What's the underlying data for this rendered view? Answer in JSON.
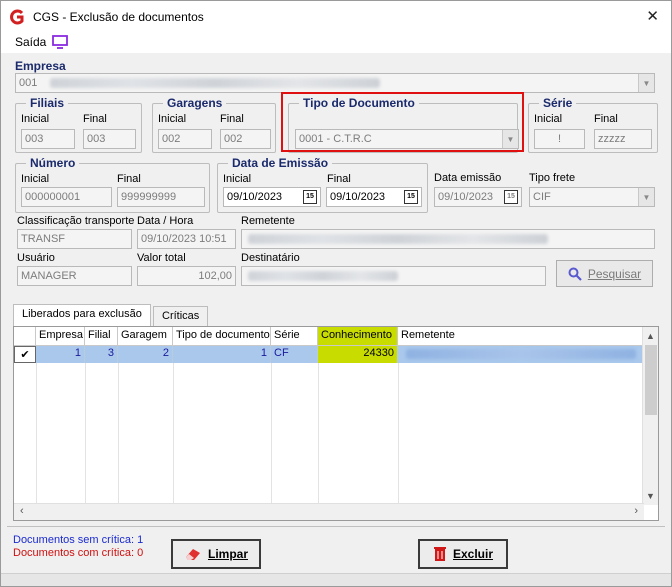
{
  "window": {
    "title": "CGS - Exclusão de documentos",
    "close_glyph": "✕"
  },
  "menu": {
    "saida": "Saída"
  },
  "empresa": {
    "label": "Empresa",
    "value": "001"
  },
  "filiais": {
    "label": "Filiais",
    "inicial_label": "Inicial",
    "final_label": "Final",
    "inicial": "003",
    "final": "003"
  },
  "garagens": {
    "label": "Garagens",
    "inicial_label": "Inicial",
    "final_label": "Final",
    "inicial": "002",
    "final": "002"
  },
  "tipo_documento": {
    "label": "Tipo de Documento",
    "value": "0001 - C.T.R.C"
  },
  "serie": {
    "label": "Série",
    "inicial_label": "Inicial",
    "final_label": "Final",
    "inicial": "!",
    "final": "zzzzz"
  },
  "numero": {
    "label": "Número",
    "inicial_label": "Inicial",
    "final_label": "Final",
    "inicial": "000000001",
    "final": "999999999"
  },
  "data_emissao": {
    "label": "Data de Emissão",
    "inicial_label": "Inicial",
    "final_label": "Final",
    "inicial": "09/10/2023",
    "final": "09/10/2023",
    "cal_glyph": "15"
  },
  "data_emissao_single": {
    "label": "Data emissão",
    "value": "09/10/2023"
  },
  "tipo_frete": {
    "label": "Tipo frete",
    "value": "CIF"
  },
  "classificacao": {
    "label": "Classificação transporte",
    "value": "TRANSF"
  },
  "data_hora": {
    "label": "Data / Hora",
    "value": "09/10/2023 10:51"
  },
  "remetente": {
    "label": "Remetente"
  },
  "usuario": {
    "label": "Usuário",
    "value": "MANAGER"
  },
  "valor_total": {
    "label": "Valor total",
    "value": "102,00"
  },
  "destinatario": {
    "label": "Destinatário"
  },
  "pesquisar_button": "Pesquisar",
  "tabs": [
    "Liberados para exclusão",
    "Críticas"
  ],
  "grid": {
    "columns": [
      "",
      "Empresa",
      "Filial",
      "Garagem",
      "Tipo de documento",
      "Série",
      "Conhecimento",
      "Remetente"
    ],
    "rows": [
      {
        "check": "✔",
        "empresa": "1",
        "filial": "3",
        "garagem": "2",
        "tipo": "1",
        "serie": "CF",
        "conhecimento": "24330"
      }
    ]
  },
  "status": {
    "sem_critica": "Documentos sem crítica: 1",
    "com_critica": "Documentos com crítica: 0"
  },
  "buttons": {
    "limpar": "Limpar",
    "excluir": "Excluir"
  },
  "colors": {
    "highlight": "#c8dc00",
    "selected_row": "#a9c8ec",
    "red_box": "#e01010"
  }
}
